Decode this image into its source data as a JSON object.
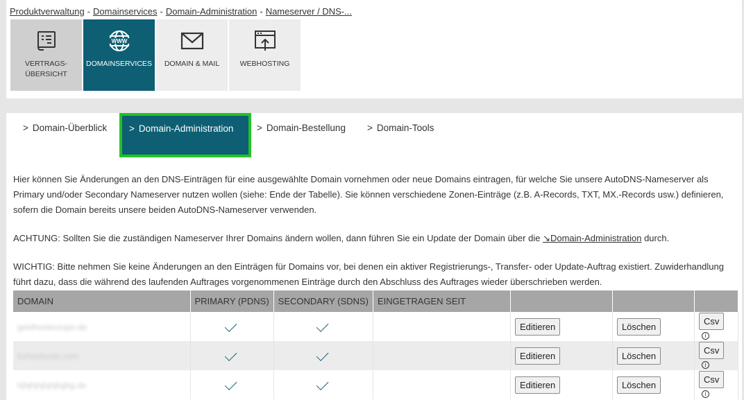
{
  "breadcrumb": {
    "items": [
      "Produktverwaltung",
      "Domainservices",
      "Domain-Administration",
      "Nameserver / DNS-..."
    ],
    "separator": "-"
  },
  "tiles": [
    {
      "label_line1": "Vertrags-",
      "label_line2": "Übersicht",
      "icon": "contract-icon",
      "state": "inactive"
    },
    {
      "label_line1": "Domainservices",
      "label_line2": "",
      "icon": "www-globe-icon",
      "state": "active"
    },
    {
      "label_line1": "Domain & Mail",
      "label_line2": "",
      "icon": "mail-icon",
      "state": "light"
    },
    {
      "label_line1": "Webhosting",
      "label_line2": "",
      "icon": "webhosting-icon",
      "state": "light"
    }
  ],
  "subtabs": {
    "overview": "Domain-Überblick",
    "administration": "Domain-Administration",
    "order": "Domain-Bestellung",
    "tools": "Domain-Tools",
    "chevron": ">"
  },
  "intro": {
    "paragraph1": "Hier können Sie Änderungen an den DNS-Einträgen für eine ausgewählte Domain vornehmen oder neue Domains eintragen, für welche Sie unsere AutoDNS-Nameserver als Primary und/oder Secondary Nameserver nutzen wollen (siehe: Ende der Tabelle). Sie können verschiedene Zonen-Einträge (z.B. A-Records, TXT, MX.-Records usw.) definieren, sofern die Domain bereits unsere beiden AutoDNS-Nameserver verwenden.",
    "warning_prefix": "ACHTUNG: Sollten Sie die zuständigen Nameserver Ihrer Domains ändern wollen, dann führen Sie ein Update der Domain über die ",
    "warning_link": "↘Domain-Administration",
    "warning_suffix": " durch.",
    "important": "WICHTIG: Bitte nehmen Sie keine Änderungen an den Einträgen für Domains vor, bei denen ein aktiver Registrierungs-, Transfer- oder Update-Auftrag existiert. Zuwiderhandlung führt dazu, dass die während des laufenden Auftrages vorgenommenen Einträge durch den Abschluss des Auftrages wieder überschrieben werden."
  },
  "table": {
    "headers": [
      "Domain",
      "Primary (PDNS)",
      "Secondary (SDNS)",
      "Eingetragen seit",
      "",
      "",
      ""
    ],
    "edit_label": "Editieren",
    "delete_label": "Löschen",
    "csv_label": "Csv",
    "info_glyph": "i",
    "rows": [
      {
        "domain": "getdhosteurope.de",
        "primary": true,
        "secondary": true,
        "since": ""
      },
      {
        "domain": "forfasthosts.com",
        "primary": true,
        "secondary": true,
        "since": ""
      },
      {
        "domain": "hjhjhjhjhjhjhghg.de",
        "primary": true,
        "secondary": true,
        "since": ""
      }
    ]
  },
  "colors": {
    "accent": "#0e5f73",
    "highlight_border": "#21c425",
    "table_header": "#a6a6a6"
  }
}
